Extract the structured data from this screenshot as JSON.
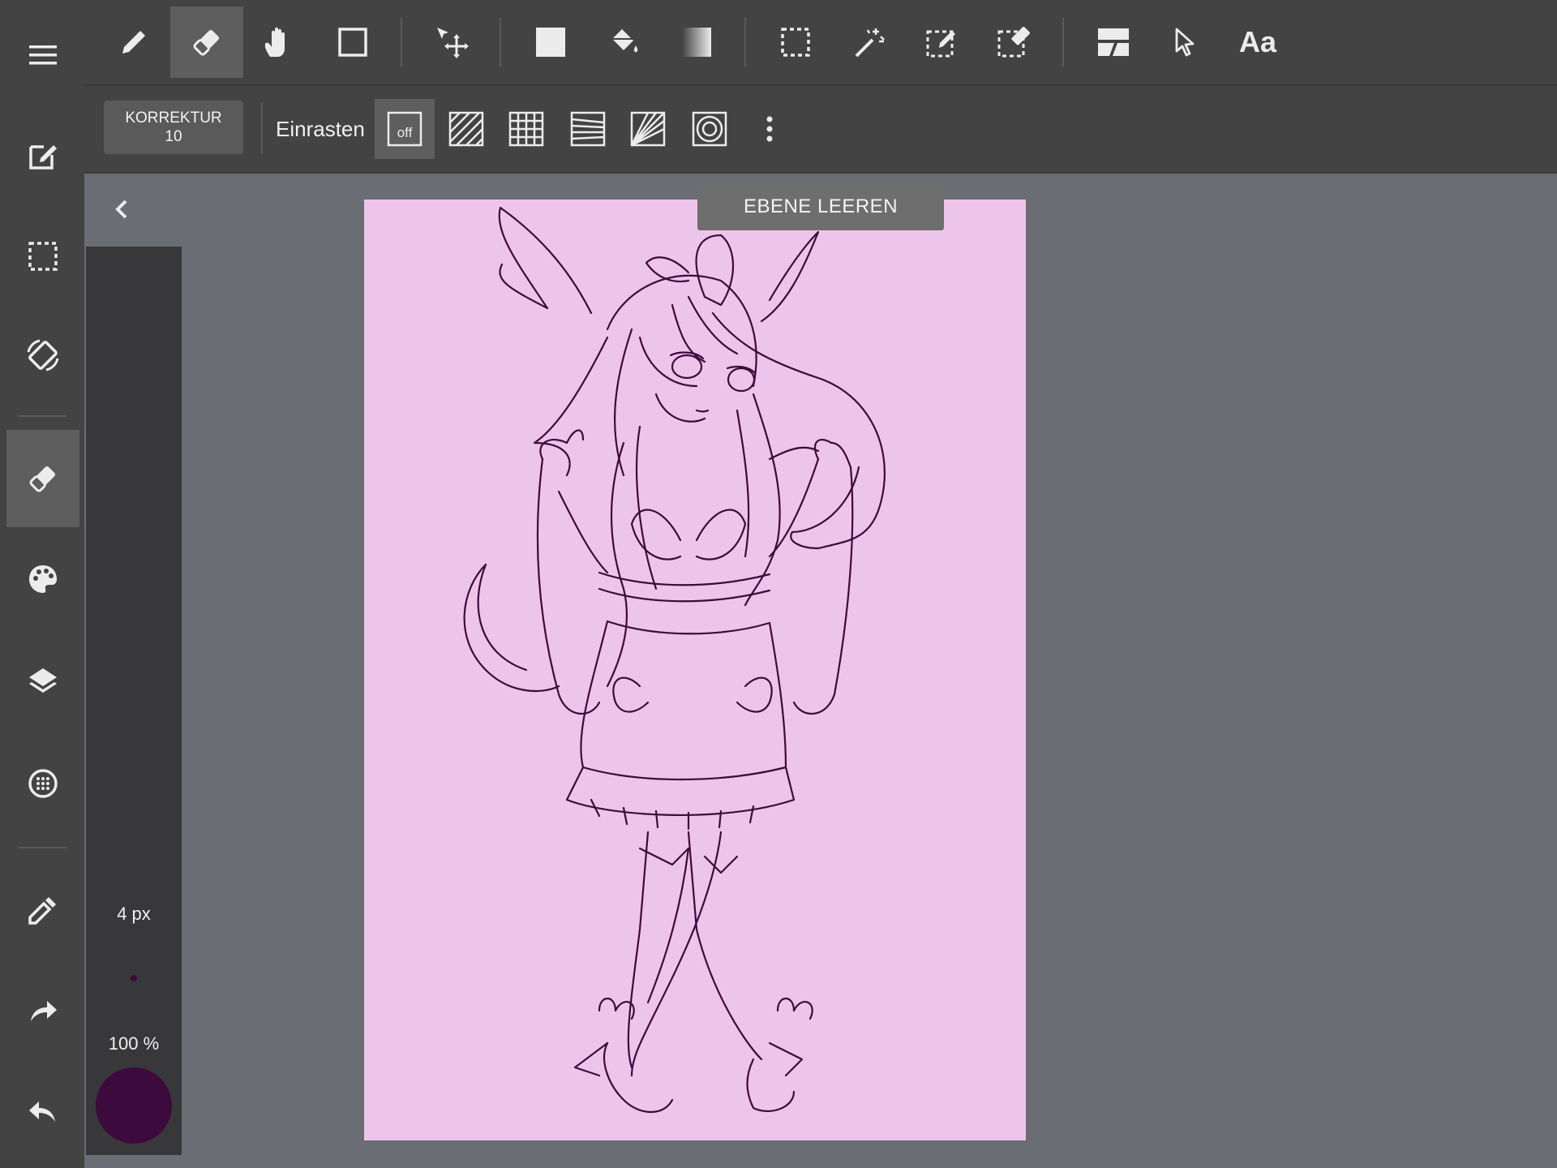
{
  "sidebar": {
    "items": [
      {
        "icon": "menu-icon"
      },
      {
        "icon": "edit-canvas-icon"
      },
      {
        "icon": "selection-icon"
      },
      {
        "icon": "rotate-canvas-icon"
      },
      {
        "icon": "eraser-icon",
        "active": true
      },
      {
        "icon": "palette-icon"
      },
      {
        "icon": "layers-icon"
      },
      {
        "icon": "material-icon"
      },
      {
        "icon": "eyedropper-icon"
      },
      {
        "icon": "redo-icon"
      },
      {
        "icon": "undo-icon"
      }
    ]
  },
  "toolbar": {
    "tools": [
      {
        "icon": "pen-tool-icon"
      },
      {
        "icon": "eraser-tool-icon",
        "active": true
      },
      {
        "icon": "hand-tool-icon"
      },
      {
        "icon": "shape-tool-icon"
      },
      {
        "icon": "move-tool-icon"
      },
      {
        "icon": "fill-rect-tool-icon"
      },
      {
        "icon": "bucket-fill-tool-icon"
      },
      {
        "icon": "gradient-tool-icon"
      },
      {
        "icon": "select-rect-tool-icon"
      },
      {
        "icon": "magic-wand-tool-icon"
      },
      {
        "icon": "select-pen-tool-icon"
      },
      {
        "icon": "select-eraser-tool-icon"
      },
      {
        "icon": "panel-tool-icon"
      },
      {
        "icon": "pointer-tool-icon"
      }
    ],
    "text_tool_label": "Aa"
  },
  "subbar": {
    "correction_label": "KORREKTUR",
    "correction_value": "10",
    "snap_label": "Einrasten",
    "snap_off_label": "off",
    "snap_options": [
      "parallel-snap-icon",
      "grid-snap-icon",
      "perspective-snap-icon",
      "radial-snap-icon",
      "circle-snap-icon"
    ]
  },
  "brush": {
    "size": "4 px",
    "opacity": "100 %",
    "color": "#3d0a3d"
  },
  "canvas": {
    "background": "#eec5ea",
    "line_color": "#3d0a3d"
  },
  "toast": {
    "text": "EBENE LEEREN"
  }
}
